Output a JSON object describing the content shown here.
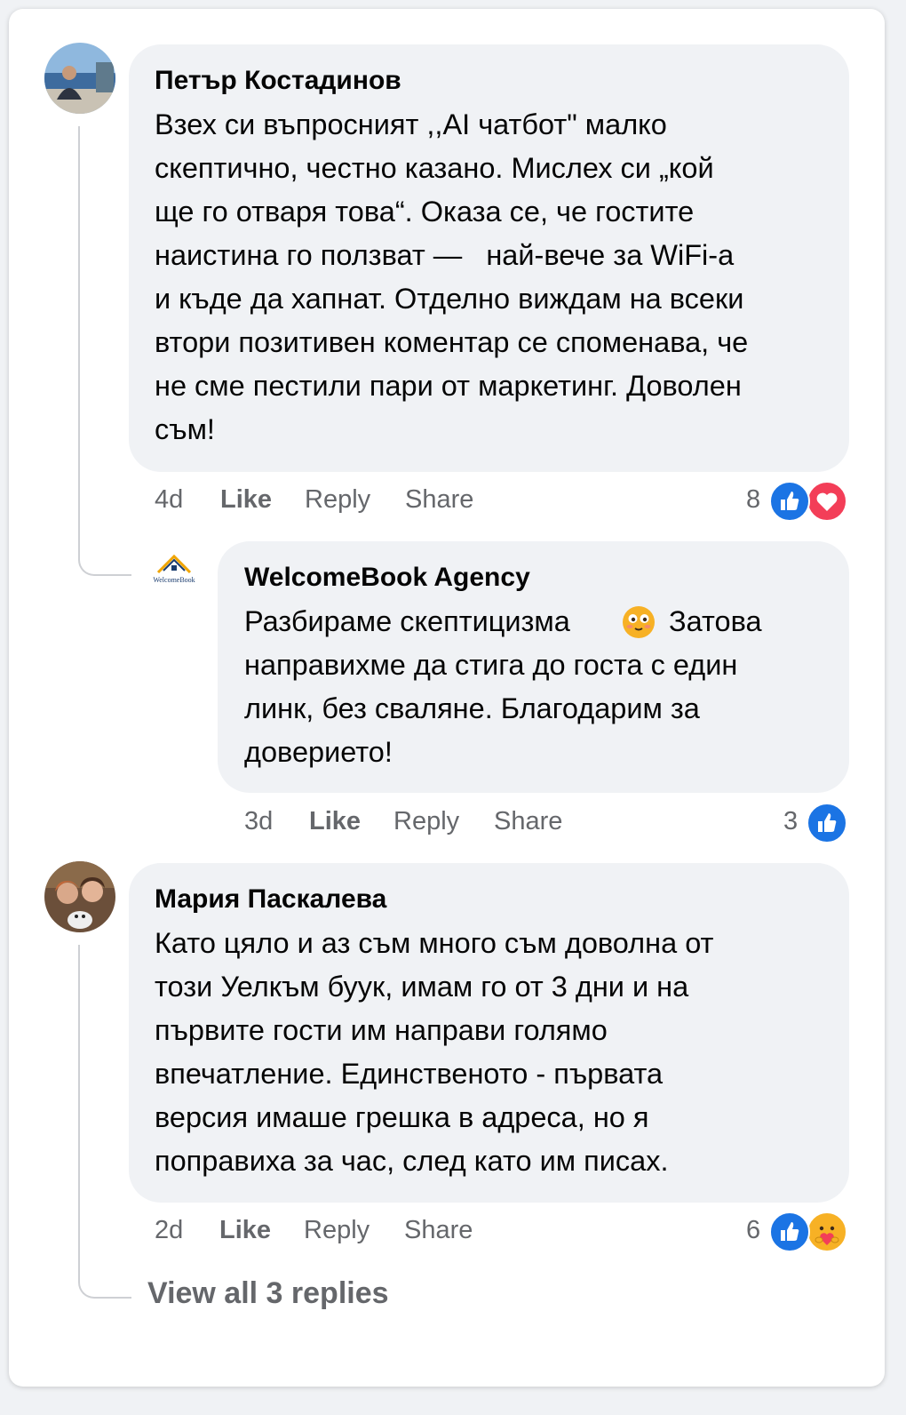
{
  "comments": [
    {
      "author": "Петър Костадинов",
      "lines": [
        "Взех си въпросният ,,AI чатбот\" малко",
        "скептично, честно казано. Мислех си „кой",
        "ще го отваря това“. Оказа се, че гостите",
        "наистина го ползват —   най-вече за WiFi-а",
        "и къде да хапнат. Отделно виждам на всеки",
        "втори позитивен коментар се споменава, че",
        "не сме пестили пари от маркетинг. Доволен",
        "съм!"
      ],
      "time": "4d",
      "like": "Like",
      "reply": "Reply",
      "share": "Share",
      "reaction_count": "8",
      "reactions": [
        "like-icon",
        "love-icon"
      ]
    },
    {
      "author": "WelcomeBook Agency",
      "lines": [
        "Разбираме скептицизма",
        "направихме да стига до госта с един",
        "линк, без сваляне. Благодарим за",
        "доверието!"
      ],
      "line1_after_emoji": "Затова",
      "avatar_logo_text": "WelcomeBook",
      "time": "3d",
      "like": "Like",
      "reply": "Reply",
      "share": "Share",
      "reaction_count": "3",
      "reactions": [
        "like-icon"
      ]
    },
    {
      "author": "Мария Паскалева",
      "lines": [
        "Като цяло и аз съм много съм доволна от",
        "този Уелкъм буук, имам го от 3 дни и на",
        "първите гости им направи голямо",
        "впечатление. Единственото - първата",
        "версия имаше грешка в адреса, но я",
        "поправиха за час, след като им писах."
      ],
      "time": "2d",
      "like": "Like",
      "reply": "Reply",
      "share": "Share",
      "reaction_count": "6",
      "reactions": [
        "like-icon",
        "care-icon"
      ]
    }
  ],
  "view_replies": "View all 3 replies",
  "colors": {
    "bubble": "#f0f2f5",
    "meta_text": "#65676b",
    "like_blue": "#1b74e4",
    "love_red": "#f33e58",
    "care_yellow": "#f7b125"
  }
}
